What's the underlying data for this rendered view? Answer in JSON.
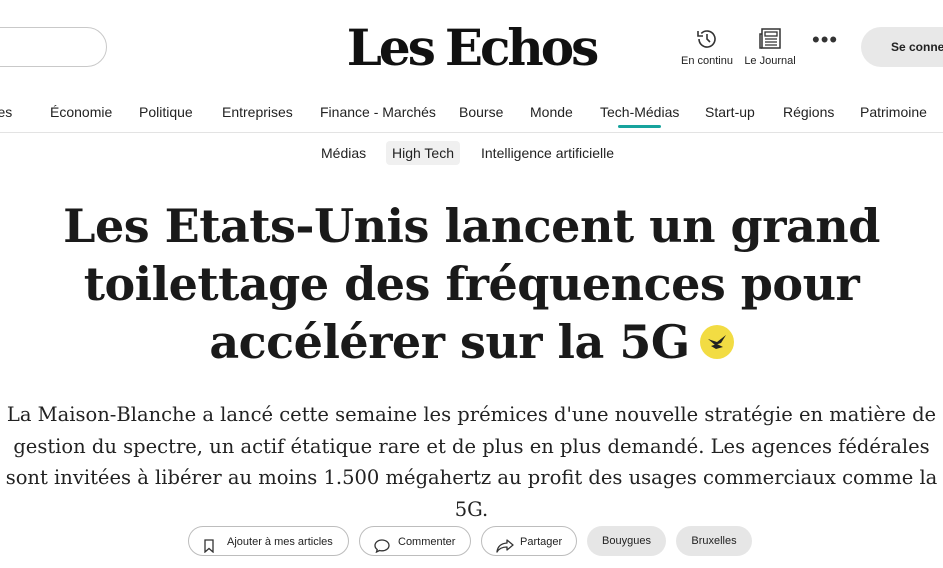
{
  "header": {
    "logo_part1": "Les",
    "logo_part2": "Echos",
    "en_continu_label": "En continu",
    "journal_label": "Le Journal",
    "more_label": "•••",
    "cta_label": "Se conne"
  },
  "nav": {
    "items": [
      {
        "label": "Idées"
      },
      {
        "label": "Économie"
      },
      {
        "label": "Politique"
      },
      {
        "label": "Entreprises"
      },
      {
        "label": "Finance - Marchés"
      },
      {
        "label": "Bourse"
      },
      {
        "label": "Monde"
      },
      {
        "label": "Tech-Médias"
      },
      {
        "label": "Start-up"
      },
      {
        "label": "Régions"
      },
      {
        "label": "Patrimoine"
      }
    ],
    "active": "Tech-Médias",
    "accent_color": "#17a39d"
  },
  "subnav": {
    "items": [
      {
        "label": "Médias"
      },
      {
        "label": "High Tech"
      },
      {
        "label": "Intelligence artificielle"
      }
    ],
    "active": "High Tech"
  },
  "article": {
    "title": "Les Etats-Unis lancent un grand toilettage des fréquences pour accélérer sur la 5G",
    "badge_icon": "premium-bird-icon",
    "badge_color": "#f2dc43",
    "lede": "La Maison-Blanche a lancé cette semaine les prémices d'une nouvelle stratégie en matière de gestion du spectre, un actif étatique rare et de plus en plus demandé. Les agences fédérales sont invitées à libérer au moins 1.500 mégahertz au profit des usages commerciaux comme la 5G."
  },
  "actions": {
    "bookmark_label": "Ajouter à mes articles",
    "comment_label": "Commenter",
    "share_label": "Partager",
    "tags": [
      {
        "label": "Bouygues"
      },
      {
        "label": "Bruxelles"
      }
    ]
  }
}
